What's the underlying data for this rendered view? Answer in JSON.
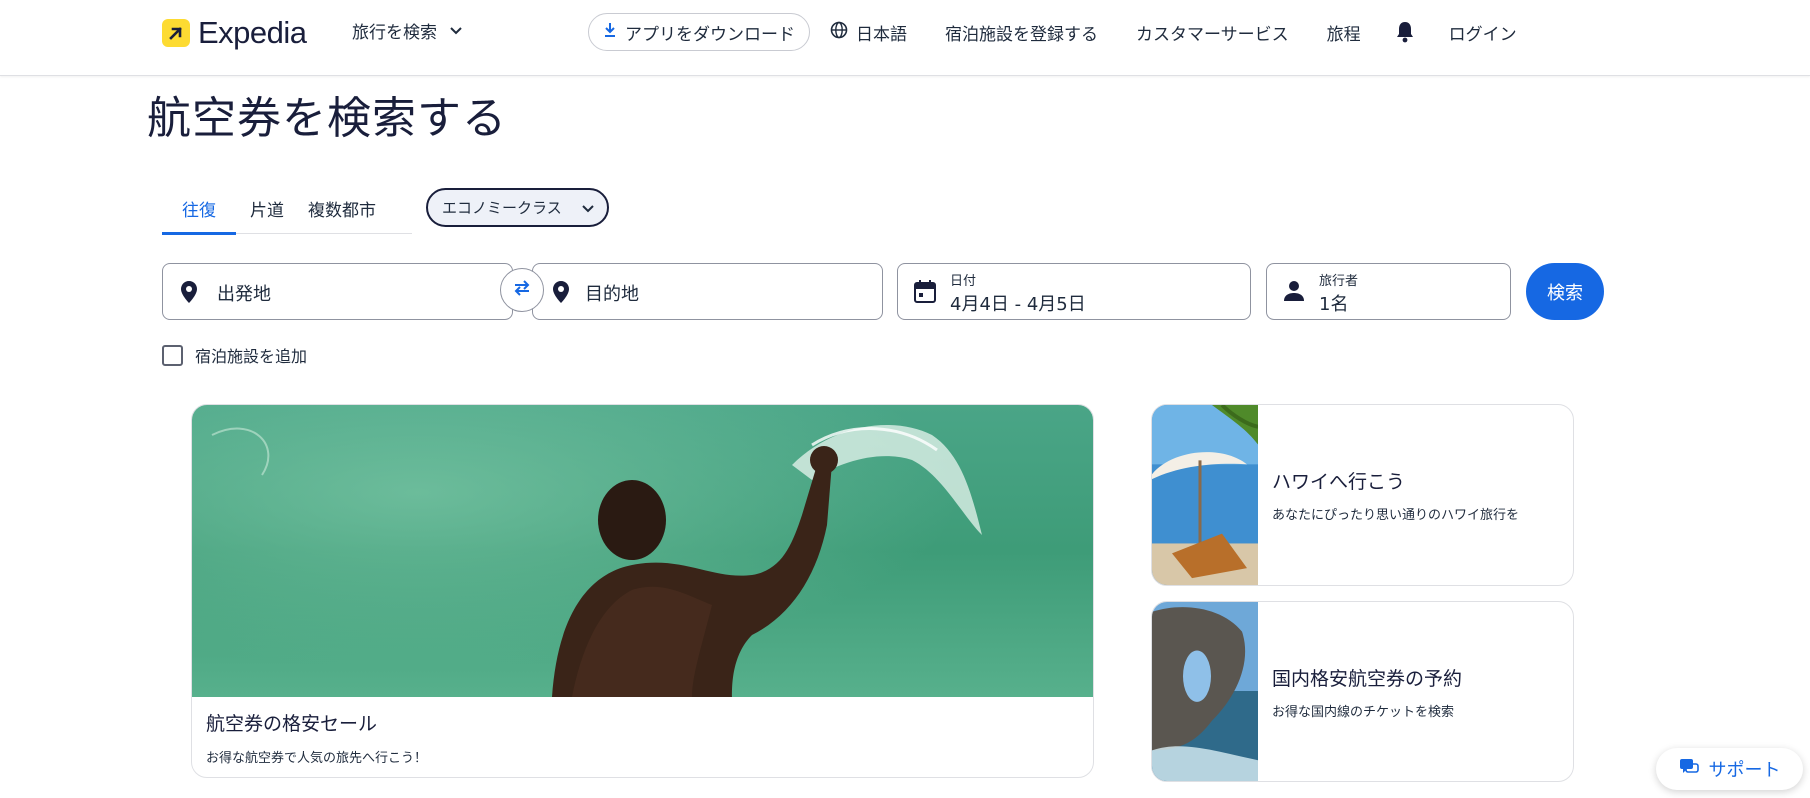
{
  "header": {
    "logo_text": "Expedia",
    "trip_search_label": "旅行を検索",
    "app_download_label": "アプリをダウンロード",
    "language_label": "日本語",
    "list_property_label": "宿泊施設を登録する",
    "customer_service_label": "カスタマーサービス",
    "trips_label": "旅程",
    "login_label": "ログイン"
  },
  "page_title": "航空券を検索する",
  "tabs": [
    {
      "label": "往復",
      "active": true
    },
    {
      "label": "片道",
      "active": false
    },
    {
      "label": "複数都市",
      "active": false
    }
  ],
  "cabin_class": "エコノミークラス",
  "search": {
    "origin_placeholder": "出発地",
    "destination_placeholder": "目的地",
    "dates_label": "日付",
    "dates_value": "4月4日 - 4月5日",
    "travelers_label": "旅行者",
    "travelers_value": "1名",
    "search_button": "検索",
    "add_stay_label": "宿泊施設を追加",
    "add_stay_checked": false
  },
  "cards": {
    "hero": {
      "title": "航空券の格安セール",
      "subtitle": "お得な航空券で人気の旅先へ行こう！"
    },
    "side": [
      {
        "title": "ハワイへ行こう",
        "subtitle": "あなたにぴったり思い通りのハワイ旅行を"
      },
      {
        "title": "国内格安航空券の予約",
        "subtitle": "お得な国内線のチケットを検索"
      }
    ]
  },
  "support_label": "サポート",
  "colors": {
    "accent": "#1668e3",
    "brand_yellow": "#fddb32",
    "text_dark": "#191e3b"
  }
}
